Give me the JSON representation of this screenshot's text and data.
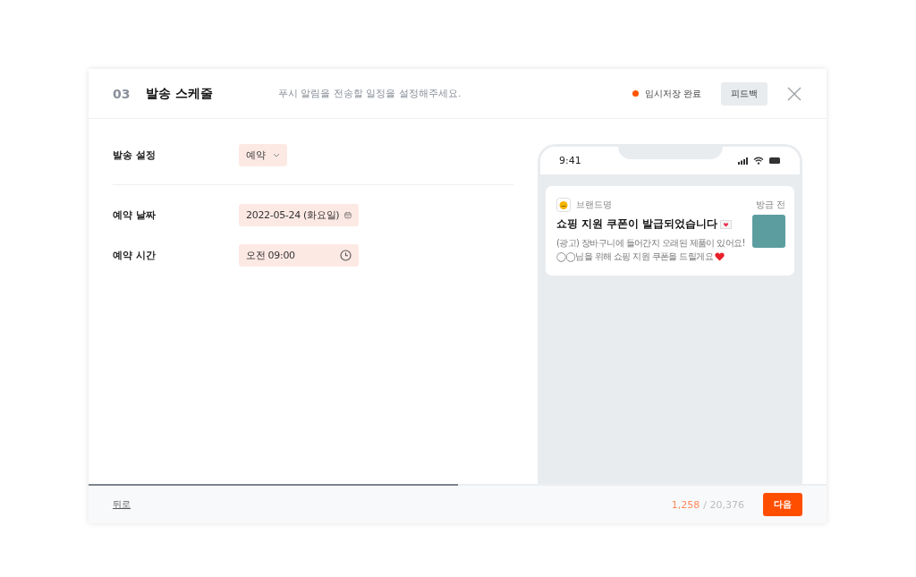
{
  "header": {
    "step": "03",
    "title": "발송 스케줄",
    "description": "푸시 알림을 전송할 일정을 설정해주세요.",
    "save_status": "임시저장 완료",
    "feedback_button": "피드백"
  },
  "form": {
    "fields": [
      {
        "kind": "select",
        "label": "발송 설정",
        "value": "예약"
      },
      {
        "kind": "date",
        "label": "예약 날짜",
        "value": "2022-05-24 (화요일)"
      },
      {
        "kind": "time",
        "label": "예약 시간",
        "value": "오전 09:00"
      }
    ]
  },
  "preview": {
    "status_time": "9:41",
    "notification": {
      "brand": "브랜드명",
      "time": "방금 전",
      "title": "쇼핑 지원 쿠폰이 발급되었습니다",
      "body_lines": [
        "(광고) 장바구니에 들어간지 오래된 제품이 있어요!",
        "◯◯님을 위해 쇼핑 지원 쿠폰을 드릴게요"
      ]
    }
  },
  "footer": {
    "progress": {
      "level": 0.5
    },
    "back_link": "뒤로",
    "count_used": "1,258",
    "count_total": "/ 20,376",
    "next_button": "다음"
  }
}
